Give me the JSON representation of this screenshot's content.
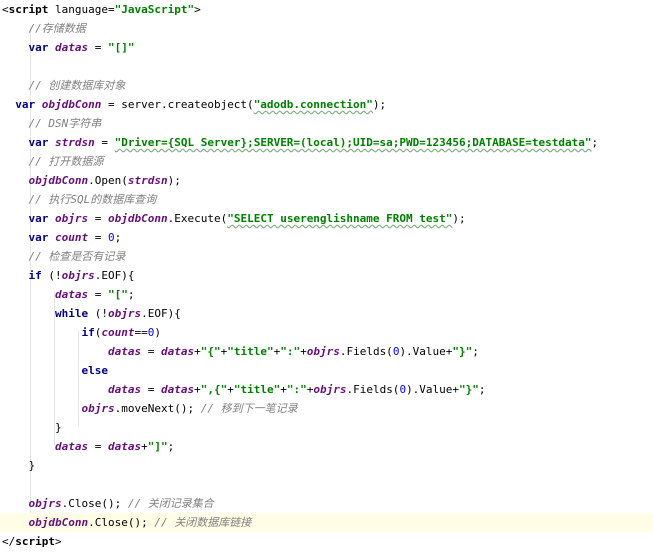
{
  "editor": {
    "colors": {
      "background": "#ffffff",
      "keyword": "#000080",
      "string": "#008000",
      "comment": "#808080",
      "variable": "#660e7a",
      "number": "#0000ff",
      "current_line": "#fffde6"
    },
    "lines": [
      [
        {
          "t": "<",
          "c": "punct"
        },
        {
          "t": "script",
          "c": "tag"
        },
        {
          "t": " language=",
          "c": "attr"
        },
        {
          "t": "\"JavaScript\"",
          "c": "str"
        },
        {
          "t": ">",
          "c": "punct"
        }
      ],
      [
        {
          "t": "    //存储数据",
          "c": "com"
        }
      ],
      [
        {
          "t": "    ",
          "c": "plain"
        },
        {
          "t": "var",
          "c": "kw"
        },
        {
          "t": " ",
          "c": "plain"
        },
        {
          "t": "datas",
          "c": "var"
        },
        {
          "t": " = ",
          "c": "plain"
        },
        {
          "t": "\"[]\"",
          "c": "str"
        }
      ],
      [],
      [
        {
          "t": "    // 创建数据库对象",
          "c": "com"
        }
      ],
      [
        {
          "t": "  ",
          "c": "plain"
        },
        {
          "t": "var",
          "c": "kw"
        },
        {
          "t": " ",
          "c": "plain"
        },
        {
          "t": "objdbConn",
          "c": "var"
        },
        {
          "t": " = server.createobject(",
          "c": "plain"
        },
        {
          "t": "\"adodb.connection\"",
          "c": "str"
        },
        {
          "t": ");",
          "c": "plain"
        }
      ],
      [
        {
          "t": "    // DSN字符串",
          "c": "com"
        }
      ],
      [
        {
          "t": "    ",
          "c": "plain"
        },
        {
          "t": "var",
          "c": "kw"
        },
        {
          "t": " ",
          "c": "plain"
        },
        {
          "t": "strdsn",
          "c": "var"
        },
        {
          "t": " = ",
          "c": "plain"
        },
        {
          "t": "\"Driver={SQL Server};SERVER=(local);UID=sa;PWD=123456;DATABASE=testdata\"",
          "c": "str"
        },
        {
          "t": ";",
          "c": "plain"
        }
      ],
      [
        {
          "t": "    // 打开数据源",
          "c": "com"
        }
      ],
      [
        {
          "t": "    ",
          "c": "plain"
        },
        {
          "t": "objdbConn",
          "c": "var"
        },
        {
          "t": ".Open(",
          "c": "plain"
        },
        {
          "t": "strdsn",
          "c": "var"
        },
        {
          "t": ");",
          "c": "plain"
        }
      ],
      [
        {
          "t": "    // 执行SQL的数据库查询",
          "c": "com"
        }
      ],
      [
        {
          "t": "    ",
          "c": "plain"
        },
        {
          "t": "var",
          "c": "kw"
        },
        {
          "t": " ",
          "c": "plain"
        },
        {
          "t": "objrs",
          "c": "var"
        },
        {
          "t": " = ",
          "c": "plain"
        },
        {
          "t": "objdbConn",
          "c": "var"
        },
        {
          "t": ".Execute(",
          "c": "plain"
        },
        {
          "t": "\"SELECT userenglishname FROM test\"",
          "c": "str"
        },
        {
          "t": ");",
          "c": "plain"
        }
      ],
      [
        {
          "t": "    ",
          "c": "plain"
        },
        {
          "t": "var",
          "c": "kw"
        },
        {
          "t": " ",
          "c": "plain"
        },
        {
          "t": "count",
          "c": "var"
        },
        {
          "t": " = ",
          "c": "plain"
        },
        {
          "t": "0",
          "c": "num"
        },
        {
          "t": ";",
          "c": "plain"
        }
      ],
      [
        {
          "t": "    // 检查是否有记录",
          "c": "com"
        }
      ],
      [
        {
          "t": "    ",
          "c": "plain"
        },
        {
          "t": "if",
          "c": "kw"
        },
        {
          "t": " (!",
          "c": "plain"
        },
        {
          "t": "objrs",
          "c": "var"
        },
        {
          "t": ".EOF){",
          "c": "plain"
        }
      ],
      [
        {
          "t": "        ",
          "c": "plain"
        },
        {
          "t": "datas",
          "c": "var"
        },
        {
          "t": " = ",
          "c": "plain"
        },
        {
          "t": "\"[\"",
          "c": "str"
        },
        {
          "t": ";",
          "c": "plain"
        }
      ],
      [
        {
          "t": "        ",
          "c": "plain"
        },
        {
          "t": "while",
          "c": "kw"
        },
        {
          "t": " (!",
          "c": "plain"
        },
        {
          "t": "objrs",
          "c": "var"
        },
        {
          "t": ".EOF){",
          "c": "plain"
        }
      ],
      [
        {
          "t": "            ",
          "c": "plain"
        },
        {
          "t": "if",
          "c": "kw"
        },
        {
          "t": "(",
          "c": "plain"
        },
        {
          "t": "count",
          "c": "var"
        },
        {
          "t": "==",
          "c": "plain"
        },
        {
          "t": "0",
          "c": "num"
        },
        {
          "t": ")",
          "c": "plain"
        }
      ],
      [
        {
          "t": "                ",
          "c": "plain"
        },
        {
          "t": "datas",
          "c": "var"
        },
        {
          "t": " = ",
          "c": "plain"
        },
        {
          "t": "datas",
          "c": "var"
        },
        {
          "t": "+",
          "c": "plain"
        },
        {
          "t": "\"{\"",
          "c": "str"
        },
        {
          "t": "+",
          "c": "plain"
        },
        {
          "t": "\"title\"",
          "c": "str"
        },
        {
          "t": "+",
          "c": "plain"
        },
        {
          "t": "\":\"",
          "c": "str"
        },
        {
          "t": "+",
          "c": "plain"
        },
        {
          "t": "objrs",
          "c": "var"
        },
        {
          "t": ".Fields(",
          "c": "plain"
        },
        {
          "t": "0",
          "c": "num"
        },
        {
          "t": ").Value+",
          "c": "plain"
        },
        {
          "t": "\"}\"",
          "c": "str"
        },
        {
          "t": ";",
          "c": "plain"
        }
      ],
      [
        {
          "t": "            ",
          "c": "plain"
        },
        {
          "t": "else",
          "c": "kw"
        }
      ],
      [
        {
          "t": "                ",
          "c": "plain"
        },
        {
          "t": "datas",
          "c": "var"
        },
        {
          "t": " = ",
          "c": "plain"
        },
        {
          "t": "datas",
          "c": "var"
        },
        {
          "t": "+",
          "c": "plain"
        },
        {
          "t": "\",{\"",
          "c": "str"
        },
        {
          "t": "+",
          "c": "plain"
        },
        {
          "t": "\"title\"",
          "c": "str"
        },
        {
          "t": "+",
          "c": "plain"
        },
        {
          "t": "\":\"",
          "c": "str"
        },
        {
          "t": "+",
          "c": "plain"
        },
        {
          "t": "objrs",
          "c": "var"
        },
        {
          "t": ".Fields(",
          "c": "plain"
        },
        {
          "t": "0",
          "c": "num"
        },
        {
          "t": ").Value+",
          "c": "plain"
        },
        {
          "t": "\"}\"",
          "c": "str"
        },
        {
          "t": ";",
          "c": "plain"
        }
      ],
      [
        {
          "t": "            ",
          "c": "plain"
        },
        {
          "t": "objrs",
          "c": "var"
        },
        {
          "t": ".moveNext(); ",
          "c": "plain"
        },
        {
          "t": "// 移到下一笔记录",
          "c": "com"
        }
      ],
      [
        {
          "t": "        }",
          "c": "plain"
        }
      ],
      [
        {
          "t": "        ",
          "c": "plain"
        },
        {
          "t": "datas",
          "c": "var"
        },
        {
          "t": " = ",
          "c": "plain"
        },
        {
          "t": "datas",
          "c": "var"
        },
        {
          "t": "+",
          "c": "plain"
        },
        {
          "t": "\"]\"",
          "c": "str"
        },
        {
          "t": ";",
          "c": "plain"
        }
      ],
      [
        {
          "t": "    }",
          "c": "plain"
        }
      ],
      [],
      [
        {
          "t": "    ",
          "c": "plain"
        },
        {
          "t": "objrs",
          "c": "var"
        },
        {
          "t": ".Close(); ",
          "c": "plain"
        },
        {
          "t": "// 关闭记录集合",
          "c": "com"
        }
      ],
      [
        {
          "t": "    ",
          "c": "plain"
        },
        {
          "t": "objdbConn",
          "c": "var"
        },
        {
          "t": ".Close(); ",
          "c": "plain"
        },
        {
          "t": "// 关闭数据库链接",
          "c": "com"
        }
      ],
      [
        {
          "t": "</",
          "c": "punct"
        },
        {
          "t": "script",
          "c": "tag"
        },
        {
          "t": ">",
          "c": "punct"
        }
      ]
    ],
    "current_line_index": 27
  }
}
